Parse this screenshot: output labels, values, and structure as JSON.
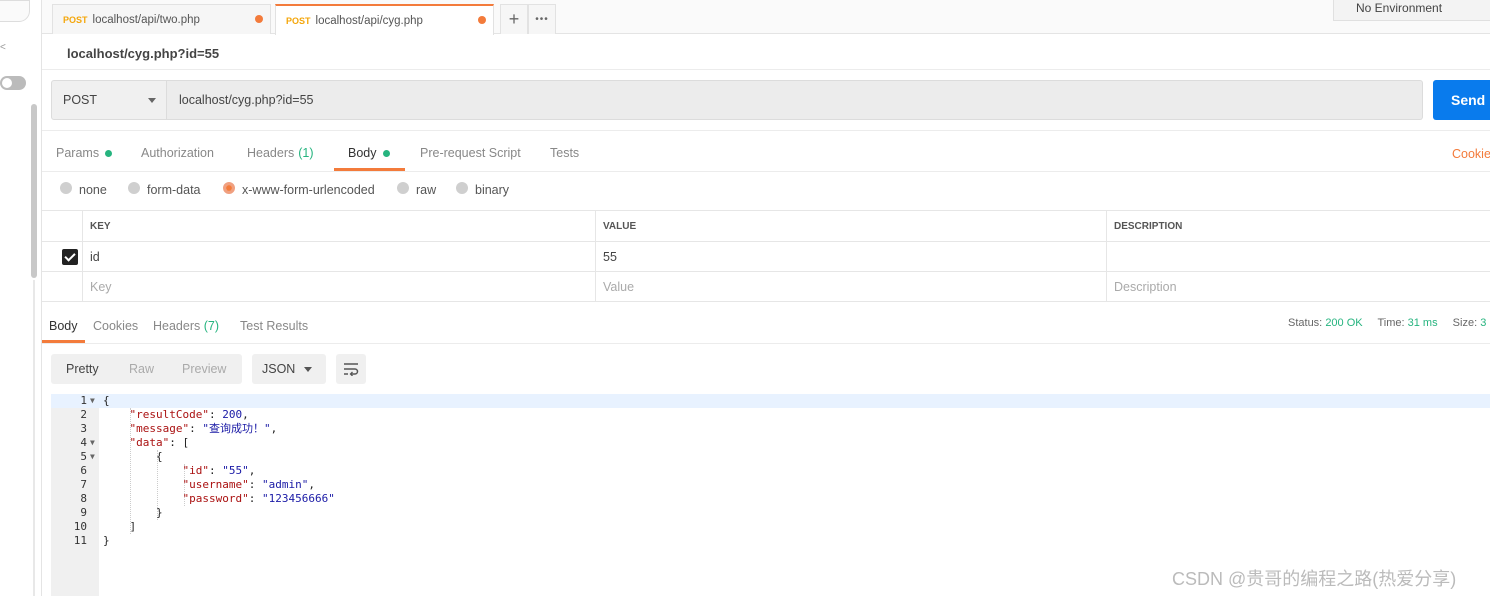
{
  "tabs": [
    {
      "method": "POST",
      "name": "localhost/api/two.php"
    },
    {
      "method": "POST",
      "name": "localhost/api/cyg.php"
    }
  ],
  "tab_actions": {
    "add": "+",
    "more": "•••"
  },
  "environment": "No Environment",
  "request": {
    "name": "localhost/cyg.php?id=55",
    "method": "POST",
    "url": "localhost/cyg.php?id=55",
    "send_label": "Send"
  },
  "request_tabs": [
    {
      "label": "Params",
      "dot": true
    },
    {
      "label": "Authorization"
    },
    {
      "label": "Headers",
      "count": "(1)"
    },
    {
      "label": "Body",
      "dot": true,
      "active": true
    },
    {
      "label": "Pre-request Script"
    },
    {
      "label": "Tests"
    }
  ],
  "cookies_label": "Cookie",
  "body_types": [
    "none",
    "form-data",
    "x-www-form-urlencoded",
    "raw",
    "binary"
  ],
  "body_type_selected": "x-www-form-urlencoded",
  "table": {
    "headers": {
      "key": "KEY",
      "value": "VALUE",
      "description": "DESCRIPTION"
    },
    "rows": [
      {
        "checked": true,
        "key": "id",
        "value": "55",
        "description": ""
      }
    ],
    "placeholders": {
      "key": "Key",
      "value": "Value",
      "description": "Description"
    }
  },
  "response_tabs": [
    {
      "label": "Body",
      "active": true
    },
    {
      "label": "Cookies"
    },
    {
      "label": "Headers",
      "count": "(7)"
    },
    {
      "label": "Test Results"
    }
  ],
  "status": {
    "status_label": "Status:",
    "status_value": "200 OK",
    "time_label": "Time:",
    "time_value": "31 ms",
    "size_label": "Size:",
    "size_value": "3"
  },
  "view_modes": [
    "Pretty",
    "Raw",
    "Preview"
  ],
  "format": "JSON",
  "code_lines": [
    "1",
    "2",
    "3",
    "4",
    "5",
    "6",
    "7",
    "8",
    "9",
    "10",
    "11"
  ],
  "json": {
    "resultCode_key": "\"resultCode\"",
    "resultCode_val": "200",
    "message_key": "\"message\"",
    "message_val": "\"查询成功！\"",
    "data_key": "\"data\"",
    "id_key": "\"id\"",
    "id_val": "\"55\"",
    "username_key": "\"username\"",
    "username_val": "\"admin\"",
    "password_key": "\"password\"",
    "password_val": "\"123456666\""
  },
  "watermark": "CSDN @贵哥的编程之路(热爱分享)"
}
